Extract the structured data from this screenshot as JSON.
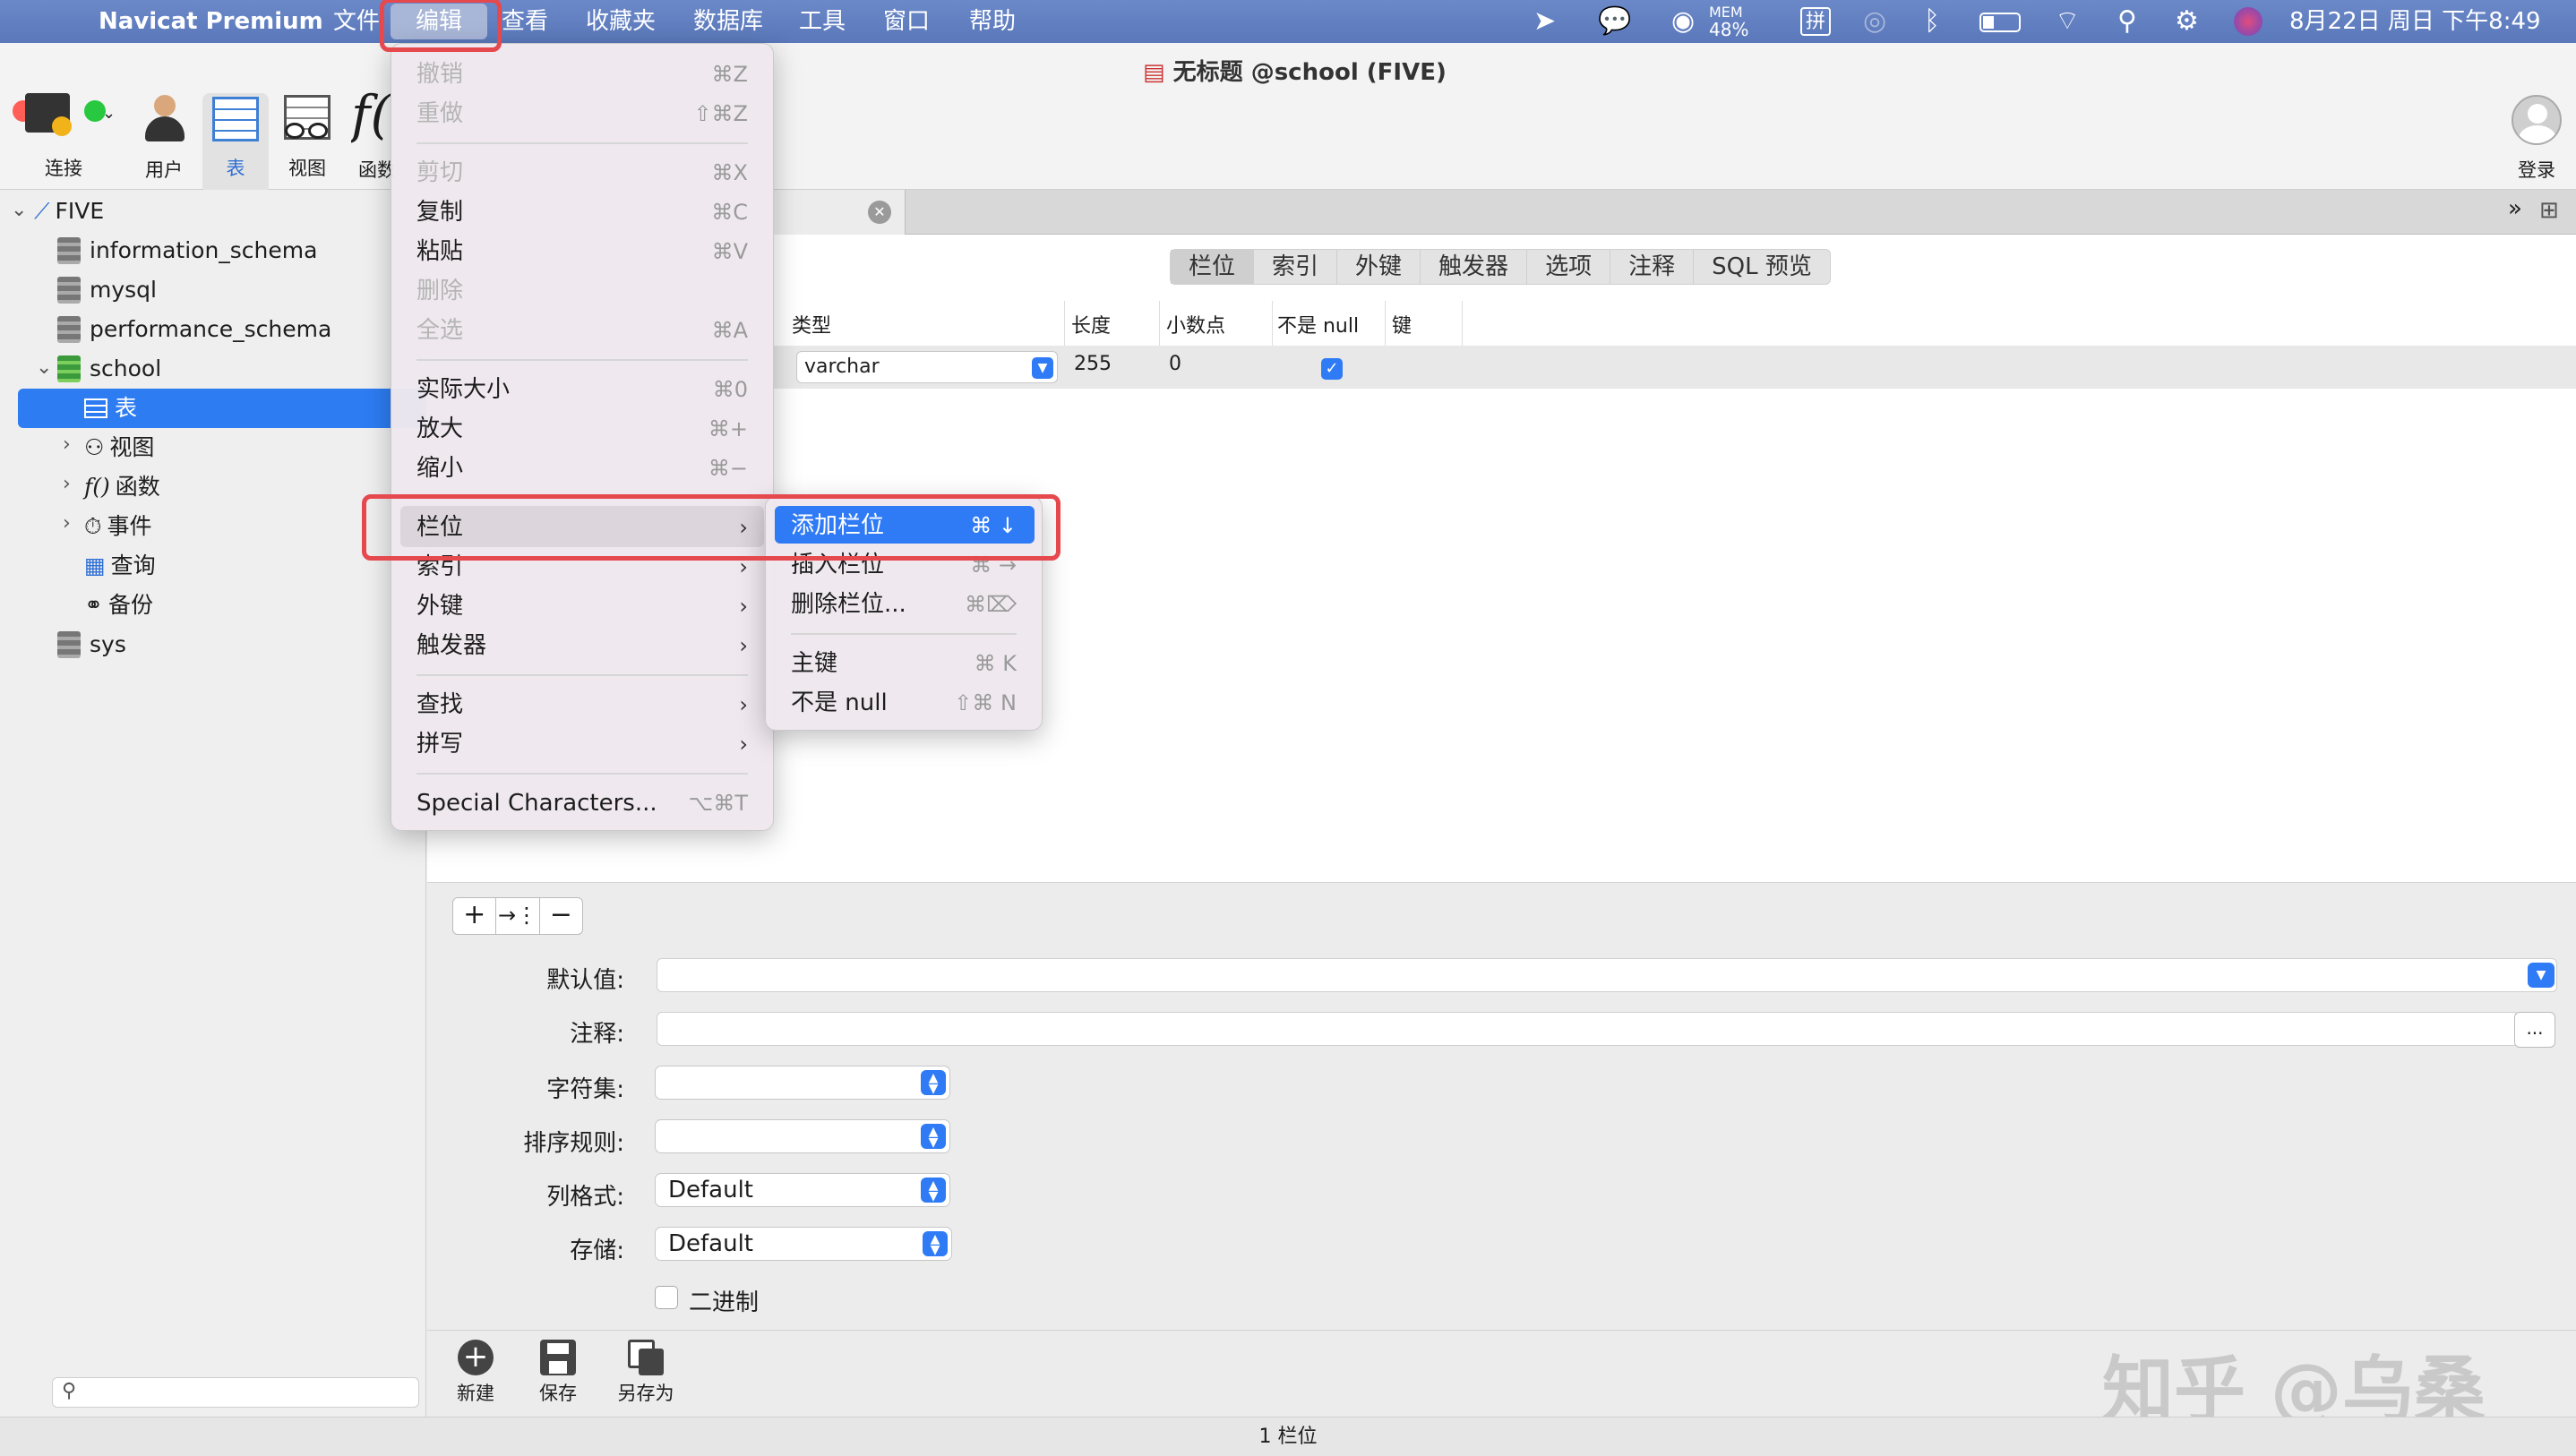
{
  "menubar": {
    "app": "Navicat Premium",
    "items": [
      "文件",
      "编辑",
      "查看",
      "收藏夹",
      "数据库",
      "工具",
      "窗口",
      "帮助"
    ],
    "mem_label": "MEM",
    "mem_value": "48%",
    "ime": "拼",
    "clock": "8月22日 周日 下午8:49"
  },
  "window": {
    "title": "无标题 @school (FIVE)"
  },
  "toolbar": {
    "connect": "连接",
    "user": "用户",
    "table": "表",
    "view": "视图",
    "function": "函数",
    "login": "登录"
  },
  "sidebar": {
    "root": "FIVE",
    "dbs": [
      "information_schema",
      "mysql",
      "performance_schema",
      "school",
      "sys"
    ],
    "school_children": [
      "表",
      "视图",
      "函数",
      "事件",
      "查询",
      "备份"
    ]
  },
  "tabs": [
    "栏位",
    "索引",
    "外键",
    "触发器",
    "选项",
    "注释",
    "SQL 预览"
  ],
  "grid": {
    "headers": [
      "类型",
      "长度",
      "小数点",
      "不是 null",
      "键"
    ],
    "row": {
      "type": "varchar",
      "length": "255",
      "decimals": "0",
      "not_null": true
    }
  },
  "edit_menu": [
    {
      "label": "撤销",
      "key": "⌘Z",
      "disabled": true
    },
    {
      "label": "重做",
      "key": "⇧⌘Z",
      "disabled": true
    },
    {
      "label": "剪切",
      "key": "⌘X",
      "disabled": true
    },
    {
      "label": "复制",
      "key": "⌘C",
      "disabled": false
    },
    {
      "label": "粘贴",
      "key": "⌘V",
      "disabled": false
    },
    {
      "label": "删除",
      "key": "",
      "disabled": true
    },
    {
      "label": "全选",
      "key": "⌘A",
      "disabled": true
    },
    {
      "label": "实际大小",
      "key": "⌘0",
      "disabled": false
    },
    {
      "label": "放大",
      "key": "⌘+",
      "disabled": false
    },
    {
      "label": "缩小",
      "key": "⌘−",
      "disabled": false
    },
    {
      "label": "栏位",
      "key": "",
      "disabled": false
    },
    {
      "label": "索引",
      "key": "",
      "disabled": false
    },
    {
      "label": "外键",
      "key": "",
      "disabled": false
    },
    {
      "label": "触发器",
      "key": "",
      "disabled": false
    },
    {
      "label": "查找",
      "key": "",
      "disabled": false
    },
    {
      "label": "拼写",
      "key": "",
      "disabled": false
    },
    {
      "label": "Special Characters...",
      "key": "⌥⌘T",
      "disabled": false
    }
  ],
  "field_submenu": [
    {
      "label": "添加栏位",
      "key": "⌘ ↓"
    },
    {
      "label": "插入栏位",
      "key": "⌘ →"
    },
    {
      "label": "删除栏位...",
      "key": "⌘⌦"
    },
    {
      "label": "主键",
      "key": "⌘ K"
    },
    {
      "label": "不是 null",
      "key": "⇧⌘ N"
    }
  ],
  "props": {
    "default_label": "默认值:",
    "comment_label": "注释:",
    "charset_label": "字符集:",
    "collation_label": "排序规则:",
    "rowformat_label": "列格式:",
    "rowformat_value": "Default",
    "storage_label": "存储:",
    "storage_value": "Default",
    "binary_label": "二进制",
    "more": "..."
  },
  "footer": {
    "new": "新建",
    "save": "保存",
    "save_as": "另存为"
  },
  "status": "1 栏位",
  "watermark": "知乎 @乌桑",
  "colors": {
    "accent": "#2f7bf6",
    "highlight_box": "#e5484d",
    "menubar": "#5f7ec0"
  }
}
